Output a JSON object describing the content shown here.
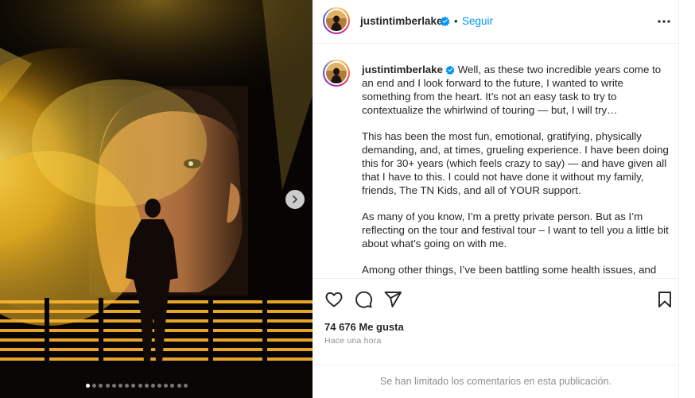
{
  "post": {
    "username": "justintimberlake",
    "follow_label": "Seguir",
    "separator": "•",
    "caption_paragraphs": [
      "Well, as these two incredible years come to an end and I look forward to the future, I wanted to write something from the heart. It’s not an easy task to try to contextualize the whirlwind of touring — but, I will try…",
      "This has been the most fun, emotional, gratifying, physically demanding, and, at times, grueling experience. I have been doing this for 30+ years (which feels crazy to say) — and have given all that I have to this. I could not have done it without my family, friends, The TN Kids, and all of YOUR support.",
      "As many of you know, I’m a pretty private person. But as I’m reflecting on the tour and festival tour – I want to tell you a little bit about what’s going on with me.",
      "Among other things, I’ve been battling some health issues, and was"
    ],
    "likes_text": "74 676 Me gusta",
    "time_text": "Hace una hora",
    "comments_notice": "Se han limitado los comentarios en esta publicación."
  },
  "carousel": {
    "count": 16,
    "active_index": 0
  },
  "icons": {
    "verified": "verified-badge-icon",
    "more": "more-options-icon",
    "like": "heart-icon",
    "comment": "comment-icon",
    "share": "share-icon",
    "save": "bookmark-icon",
    "next": "chevron-right-icon"
  },
  "colors": {
    "link": "#0095f6",
    "verified": "#0095f6",
    "muted": "#8e8e8e"
  }
}
